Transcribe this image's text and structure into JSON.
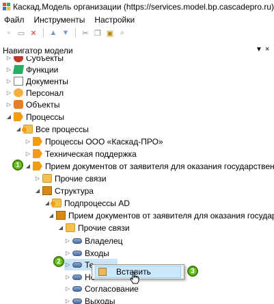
{
  "window": {
    "title": "Каскад.Модель организации (https://services.model.bp.cascadepro.ru)"
  },
  "menu": [
    "Файл",
    "Инструменты",
    "Настройки"
  ],
  "navigator": {
    "title": "Навигатор модели",
    "pin_icon": "pin-icon",
    "close_label": "×"
  },
  "tree": {
    "subjects": "Субъекты",
    "functions": "Функции",
    "documents": "Документы",
    "personnel": "Персонал",
    "objects": "Объекты",
    "processes": "Процессы",
    "all_processes": "Все процессы",
    "processes_ooo": "Процессы ООО «Каскад-ПРО»",
    "tech_support": "Техническая поддержка",
    "receive_docs": "Прием документов от заявителя для оказания государственной, м",
    "other_links": "Прочие связи",
    "structure": "Структура",
    "subprocesses_ad": "Подпроцессы AD",
    "receive_docs_sub": "Прием документов от заявителя для оказания государстве",
    "other_links_sub": "Прочие связи",
    "owner": "Владелец",
    "inputs": "Входы",
    "te_partial": "Те",
    "no_partial": "Но",
    "approval": "Согласование",
    "outputs": "Выходы"
  },
  "context_menu": {
    "paste_label": "Вставить"
  },
  "badges": [
    "1",
    "2",
    "3"
  ],
  "colors": {
    "badge_green": "#6abf1e",
    "selection": "#cce8ff",
    "process_orange": "#f39c12"
  }
}
